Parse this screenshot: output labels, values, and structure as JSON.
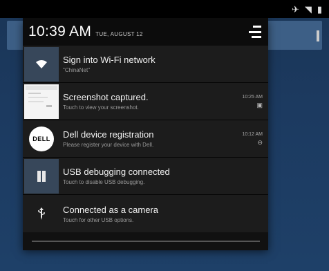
{
  "status_bar": {
    "icons": [
      "airplane-icon",
      "wifi-icon",
      "battery-icon"
    ]
  },
  "header": {
    "time": "10:39 AM",
    "date": "TUE, AUGUST 12",
    "settings_icon": "quick-settings-icon"
  },
  "notifications": [
    {
      "icon": "wifi-icon",
      "title": "Sign into Wi-Fi network",
      "text": "\"ChinaNet\"",
      "time": "",
      "meta_icon": ""
    },
    {
      "icon": "screenshot-thumbnail",
      "title": "Screenshot captured.",
      "text": "Touch to view your screenshot.",
      "time": "10:25 AM",
      "meta_icon": "image-icon"
    },
    {
      "icon": "dell-logo",
      "logo_text": "DELL",
      "title": "Dell device registration",
      "text": "Please register your device with Dell.",
      "time": "10:12 AM",
      "meta_icon": "minus-circle-icon"
    },
    {
      "icon": "usb-debug-icon",
      "title": "USB debugging connected",
      "text": "Touch to disable USB debugging.",
      "time": "",
      "meta_icon": ""
    },
    {
      "icon": "usb-icon",
      "title": "Connected as a camera",
      "text": "Touch for other USB options.",
      "time": "",
      "meta_icon": ""
    }
  ]
}
